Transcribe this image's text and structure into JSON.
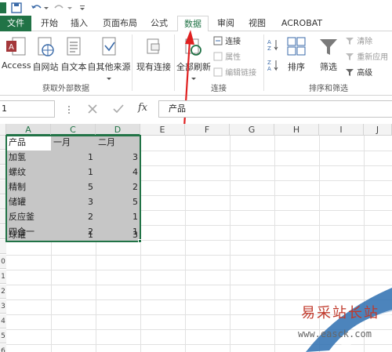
{
  "tabs": [
    {
      "label": "文件"
    },
    {
      "label": "开始"
    },
    {
      "label": "插入"
    },
    {
      "label": "页面布局"
    },
    {
      "label": "公式"
    },
    {
      "label": "数据"
    },
    {
      "label": "审阅"
    },
    {
      "label": "视图"
    },
    {
      "label": "ACROBAT"
    }
  ],
  "ribbon": {
    "get_external": {
      "access": "Access",
      "web": "自网站",
      "text": "自文本",
      "other": "自其他来源",
      "group_label": "获取外部数据"
    },
    "existing": "现有连接",
    "refresh_all": "全部刷新",
    "connections": {
      "conn": "连接",
      "props": "属性",
      "edit_links": "编辑链接",
      "group_label": "连接"
    },
    "sort_filter": {
      "sort": "排序",
      "filter": "筛选",
      "clear": "清除",
      "reapply": "重新应用",
      "advanced": "高级",
      "group_label": "排序和筛选"
    }
  },
  "formula_bar": {
    "name_box": "1",
    "fx": "fx",
    "content": "产品"
  },
  "columns": [
    "A",
    "C",
    "D",
    "E",
    "F",
    "G",
    "H",
    "I",
    "J"
  ],
  "table": {
    "headers": [
      "产品",
      "一月",
      "二月"
    ],
    "rows": [
      [
        "加氢",
        "1",
        "3"
      ],
      [
        "螺纹",
        "1",
        "4"
      ],
      [
        "精制",
        "5",
        "2"
      ],
      [
        "储罐",
        "3",
        "5"
      ],
      [
        "反应釜",
        "2",
        "1"
      ],
      [
        "四合一",
        "2",
        "1"
      ],
      [
        "球罐",
        "1",
        "3"
      ]
    ]
  },
  "row_numbers": [
    "",
    "",
    "",
    "",
    "",
    "",
    "",
    "",
    "0",
    "1",
    "2",
    "3",
    "4",
    "5",
    "6"
  ],
  "watermark": {
    "title": "易采站长站",
    "url": "www.easck.com"
  },
  "colors": {
    "accent": "#217346",
    "arrow": "#e02020"
  }
}
